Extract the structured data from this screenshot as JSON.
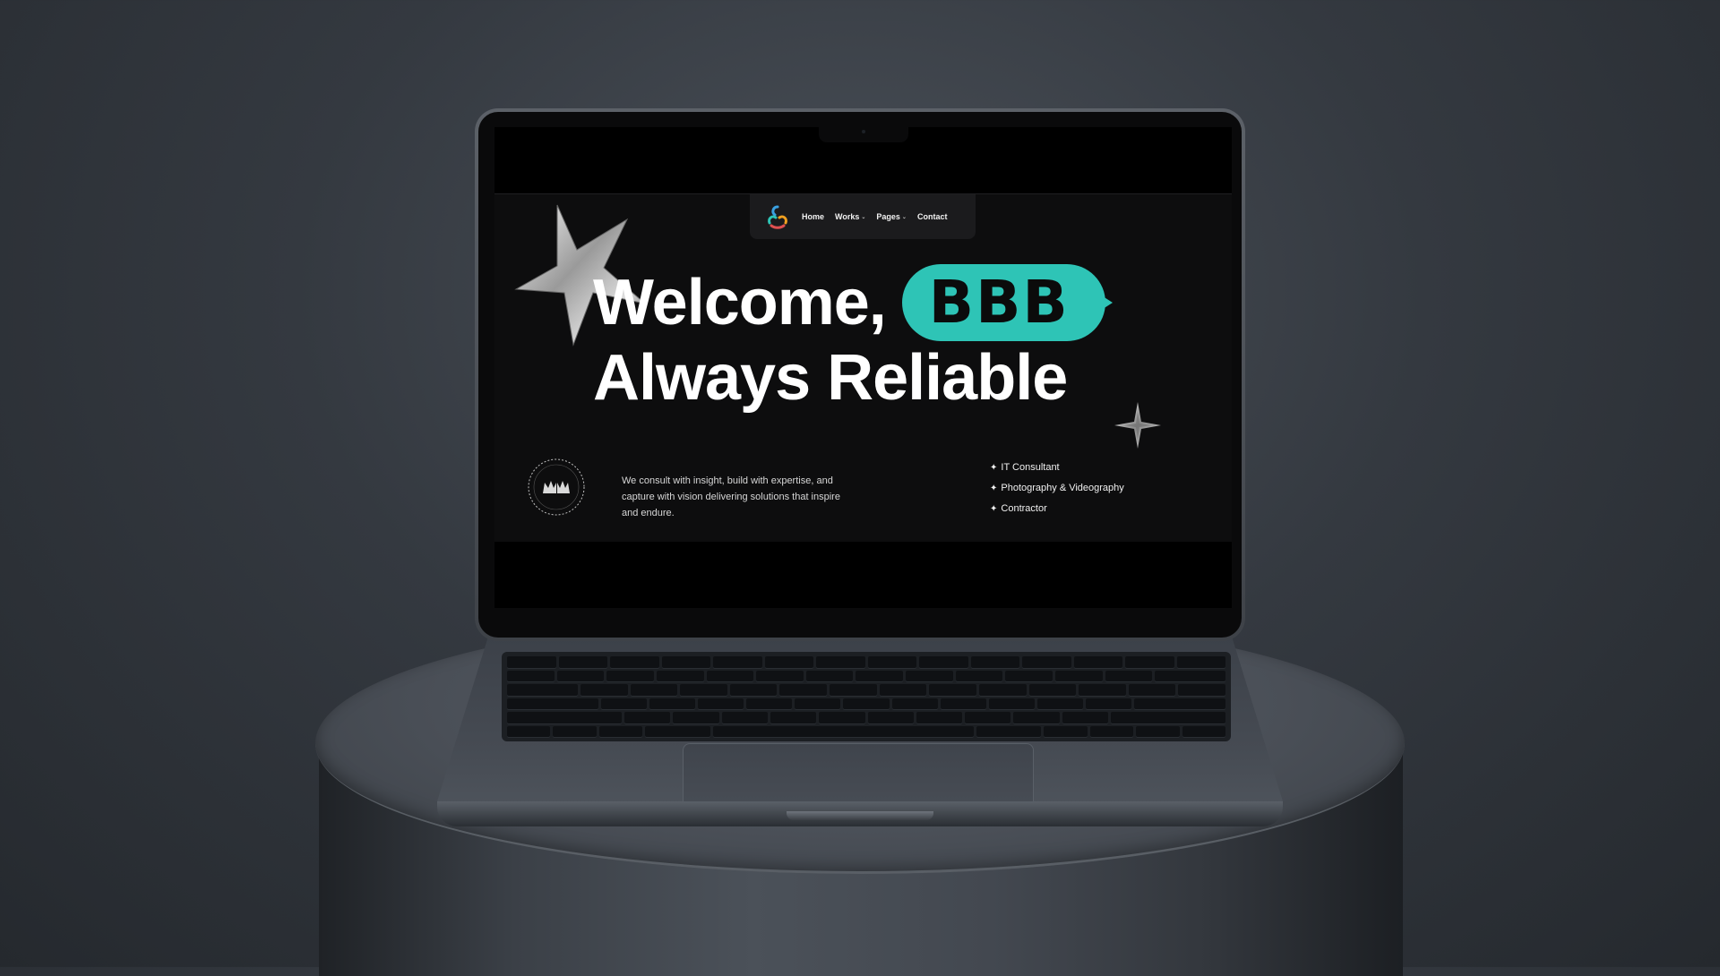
{
  "nav": {
    "logo_icon": "tri-loop-logo",
    "items": [
      {
        "label": "Home",
        "has_dropdown": false
      },
      {
        "label": "Works",
        "has_dropdown": true
      },
      {
        "label": "Pages",
        "has_dropdown": true
      },
      {
        "label": "Contact",
        "has_dropdown": false
      }
    ]
  },
  "hero": {
    "line1_prefix": "Welcome,",
    "highlight": "BBB",
    "line2": "Always Reliable"
  },
  "intro": {
    "description": "We consult with insight, build with expertise, and capture with vision delivering solutions that inspire and endure.",
    "badge_icon": "circular-crown-emblem"
  },
  "services": [
    {
      "mark": "✦",
      "label": "IT Consultant"
    },
    {
      "mark": "✦",
      "label": "Photography & Videography"
    },
    {
      "mark": "✦",
      "label": "Contractor"
    }
  ],
  "colors": {
    "accent": "#2ec4b6",
    "site_background": "#0d0d0e",
    "nav_background": "#1b1b1d",
    "text": "#ffffff"
  }
}
